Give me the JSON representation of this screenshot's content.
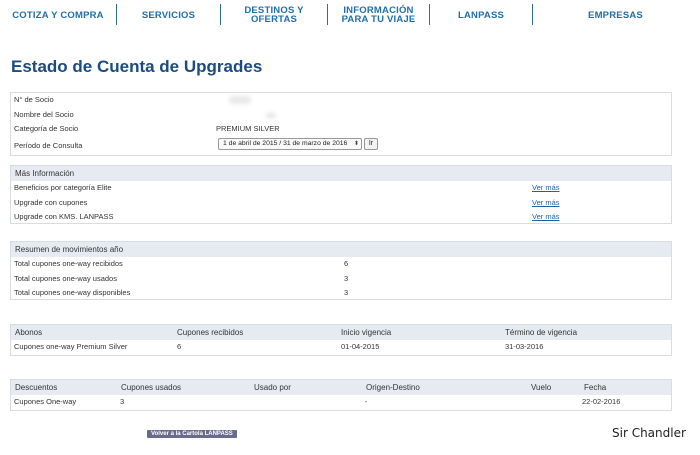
{
  "nav": [
    {
      "label": "COTIZA Y COMPRA",
      "width": 116
    },
    {
      "label": "SERVICIOS",
      "width": 98
    },
    {
      "label": "DESTINOS Y OFERTAS",
      "width": 106
    },
    {
      "label": "INFORMACIÓN\nPARA TU VIAJE",
      "width": 101
    },
    {
      "label": "LANPASS",
      "width": 102
    },
    {
      "label": "EMPRESAS",
      "width": 174
    }
  ],
  "page_title": "Estado de Cuenta de Upgrades",
  "member": {
    "rows": [
      {
        "label": "N° de Socio",
        "value": ""
      },
      {
        "label": "Nombre del Socio",
        "value": ""
      },
      {
        "label": "Categoría de Socio",
        "value": "PREMIUM SILVER"
      },
      {
        "label": "Período de Consulta",
        "value": ""
      }
    ],
    "period_value": "1 de abril de 2015 / 31 de marzo de 2016",
    "go_label": "Ir"
  },
  "more_info": {
    "title": "Más Información",
    "rows": [
      {
        "label": "Beneficios por categoría Elite",
        "link": "Ver más"
      },
      {
        "label": "Upgrade con cupones",
        "link": "Ver más"
      },
      {
        "label": "Upgrade con KMS. LANPASS",
        "link": "Ver más"
      }
    ]
  },
  "summary": {
    "title": "Resumen de movimientos año",
    "rows": [
      {
        "label": "Total cupones one-way recibidos",
        "value": "6"
      },
      {
        "label": "Total cupones one-way usados",
        "value": "3"
      },
      {
        "label": "Total cupones one-way disponibles",
        "value": "3"
      }
    ]
  },
  "abonos": {
    "headers": [
      "Abonos",
      "Cupones recibidos",
      "Inicio vigencia",
      "Término de vigencia"
    ],
    "rows": [
      [
        "Cupones one-way Premium Silver",
        "6",
        "01-04-2015",
        "31-03-2016"
      ]
    ]
  },
  "descuentos": {
    "headers": [
      "Descuentos",
      "Cupones usados",
      "Usado por",
      "Origen-Destino",
      "Vuelo",
      "Fecha"
    ],
    "rows": [
      [
        "Cupones One-way",
        "3",
        "",
        "-",
        "",
        "22-02-2016"
      ]
    ]
  },
  "back_label": "Volver a la Cartola LANPASS",
  "watermark": "Sir Chandler"
}
